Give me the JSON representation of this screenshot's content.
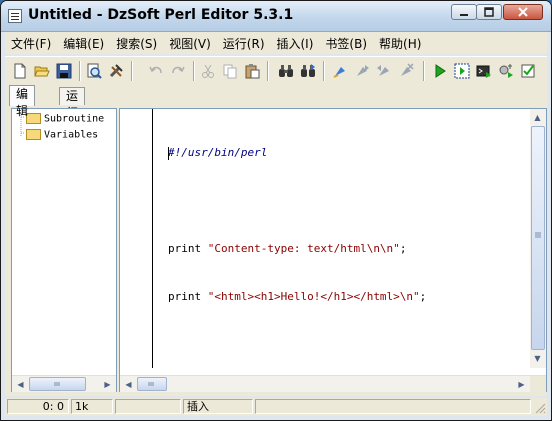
{
  "window": {
    "title": "Untitled - DzSoft Perl Editor 5.3.1"
  },
  "menu": [
    "文件(F)",
    "编辑(E)",
    "搜索(S)",
    "视图(V)",
    "运行(R)",
    "插入(I)",
    "书签(B)",
    "帮助(H)"
  ],
  "tabs": [
    {
      "label": "编辑",
      "active": true
    },
    {
      "label": "运行",
      "active": false
    }
  ],
  "tree": [
    {
      "label": "Subroutine"
    },
    {
      "label": "Variables"
    }
  ],
  "code": {
    "line1": "#!/usr/bin/perl",
    "line2": "",
    "line3_kw": "print ",
    "line3_str": "\"Content-type: text/html\\n\\n\"",
    "line3_end": ";",
    "line4_kw": "print ",
    "line4_str": "\"<html><h1>Hello!</h1></html>\\n\"",
    "line4_end": ";"
  },
  "status": {
    "position": "0: 0",
    "size": "1k",
    "col3": "",
    "mode": "插入",
    "col5": ""
  },
  "colors": {
    "comment": "#000080",
    "string": "#8b0000",
    "titlebar": "#c3d7ec"
  }
}
